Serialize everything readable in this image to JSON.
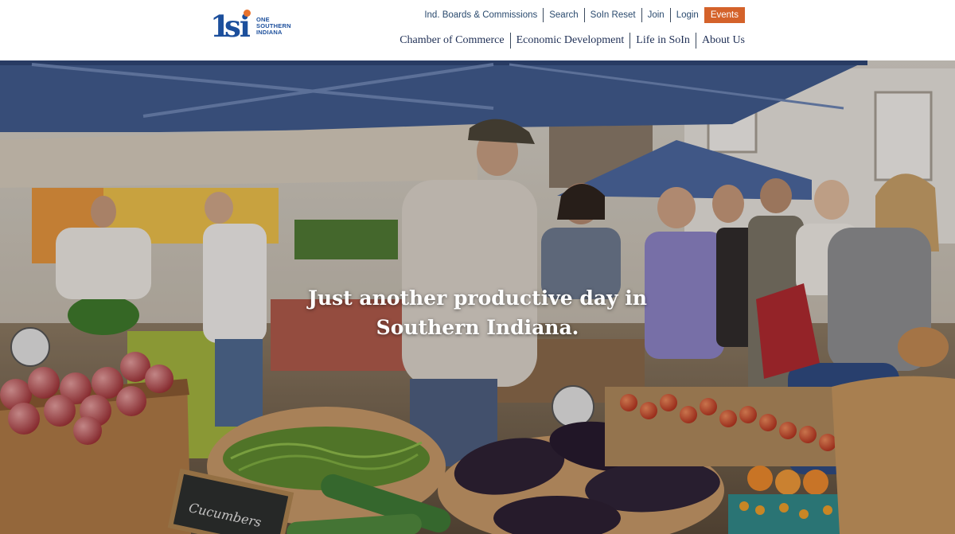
{
  "brand": {
    "logo_mark": "1si",
    "logo_lines": [
      "ONE",
      "SOUTHERN",
      "INDIANA"
    ],
    "colors": {
      "primary": "#1c4f9c",
      "accent": "#e8732e",
      "events": "#d4622a",
      "nav_text": "#1f2f55"
    }
  },
  "utility_nav": {
    "items": [
      "Ind. Boards & Commissions",
      "Search",
      "SoIn Reset",
      "Join",
      "Login"
    ],
    "events_label": "Events"
  },
  "main_nav": {
    "items": [
      "Chamber of Commerce",
      "Economic Development",
      "Life in SoIn",
      "About Us"
    ]
  },
  "hero": {
    "heading_line1": "Just another productive day in",
    "heading_line2": "Southern Indiana.",
    "sign_text": "Cucumbers",
    "image_icon": "farmers-market-photo"
  }
}
